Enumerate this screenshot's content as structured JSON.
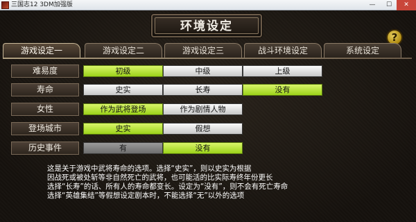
{
  "window": {
    "title": "三国志12 3DM加强版",
    "min": "—",
    "max": "☐",
    "close": "✕"
  },
  "header": {
    "title": "环境设定",
    "help": "?"
  },
  "tabs": [
    {
      "label": "游戏设定一",
      "active": true
    },
    {
      "label": "游戏设定二",
      "active": false
    },
    {
      "label": "游戏设定三",
      "active": false
    },
    {
      "label": "战斗环境设定",
      "active": false
    },
    {
      "label": "系统设定",
      "active": false
    }
  ],
  "settings": [
    {
      "label": "难易度",
      "options": [
        {
          "text": "初级",
          "state": "selected"
        },
        {
          "text": "中级",
          "state": "normal"
        },
        {
          "text": "上级",
          "state": "normal"
        }
      ]
    },
    {
      "label": "寿命",
      "options": [
        {
          "text": "史实",
          "state": "normal"
        },
        {
          "text": "长寿",
          "state": "normal"
        },
        {
          "text": "没有",
          "state": "selected"
        }
      ]
    },
    {
      "label": "女性",
      "options": [
        {
          "text": "作为武将登场",
          "state": "selected"
        },
        {
          "text": "作为剧情人物",
          "state": "normal"
        }
      ]
    },
    {
      "label": "登场城市",
      "options": [
        {
          "text": "史实",
          "state": "selected"
        },
        {
          "text": "假想",
          "state": "normal"
        }
      ]
    },
    {
      "label": "历史事件",
      "options": [
        {
          "text": "有",
          "state": "dim"
        },
        {
          "text": "没有",
          "state": "selected"
        }
      ]
    }
  ],
  "description": [
    "这是关于游戏中武将寿命的选项。选择“史实”，则以史实为根据",
    "因战死或被处斩等非自然死亡的武将，也可能活的比实际寿终年份更长",
    "选择“长寿”的话、所有人的寿命都变长。设定为“没有”，则不会有死亡寿命",
    "选择“英雄集结”等假想设定剧本时，不能选择“无”以外的选项"
  ],
  "colors": {
    "selected": "#9cd21a",
    "accent": "#c8b898"
  }
}
